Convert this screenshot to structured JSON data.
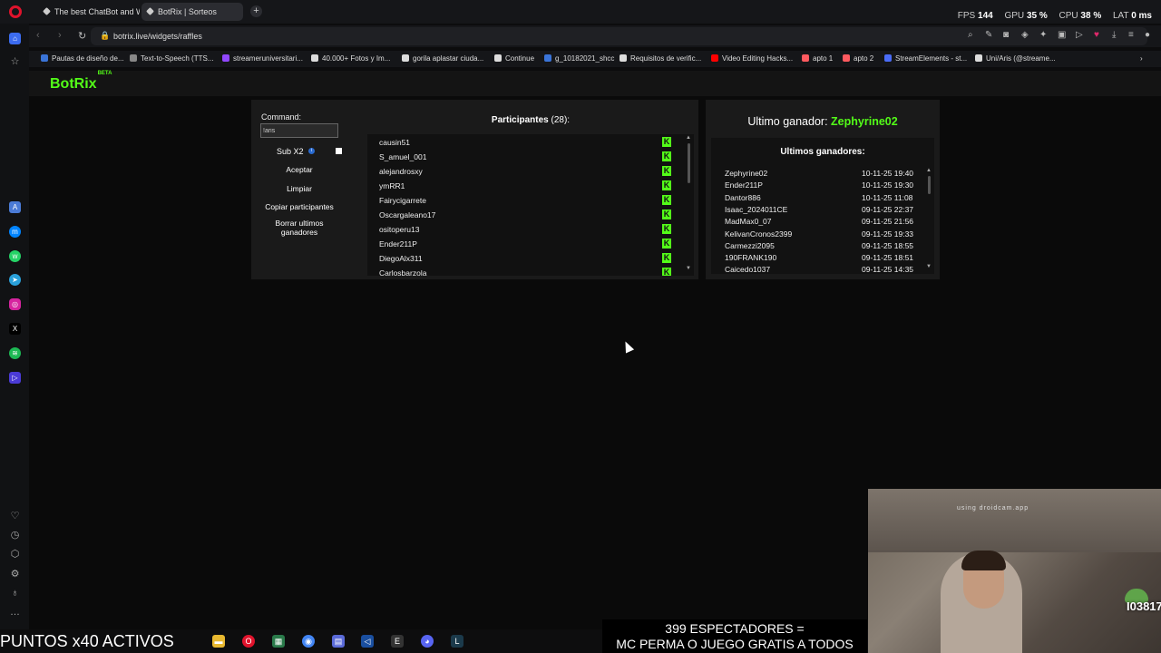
{
  "browser": {
    "tabs": [
      {
        "label": "The best ChatBot and Wi"
      },
      {
        "label": "BotRix | Sorteos"
      }
    ],
    "stats": {
      "fps_label": "FPS",
      "fps": "144",
      "gpu_label": "GPU",
      "gpu": "35 %",
      "cpu_label": "CPU",
      "cpu": "38 %",
      "lat_label": "LAT",
      "lat": "0 ms"
    },
    "url": "botrix.live/widgets/raffles",
    "bookmarks": [
      {
        "label": "Pautas de diseño de...",
        "color": "#3a74d8"
      },
      {
        "label": "Text-to-Speech (TTS...",
        "color": "#888888"
      },
      {
        "label": "streameruniversitari...",
        "color": "#9147ff"
      },
      {
        "label": "40.000+ Fotos y Im...",
        "color": "#dddddd"
      },
      {
        "label": "gorila aplastar ciuda...",
        "color": "#dddddd"
      },
      {
        "label": "Continue",
        "color": "#dddddd"
      },
      {
        "label": "g_10182021_shcc",
        "color": "#3a74d8"
      },
      {
        "label": "Requisitos de verific...",
        "color": "#dddddd"
      },
      {
        "label": "Video Editing Hacks...",
        "color": "#ff0000"
      },
      {
        "label": "apto 1",
        "color": "#ff5a5f"
      },
      {
        "label": "apto 2",
        "color": "#ff5a5f"
      },
      {
        "label": "StreamElements - st...",
        "color": "#4a6cf7"
      },
      {
        "label": "Uni/Aris (@streame...",
        "color": "#dddddd"
      }
    ]
  },
  "app": {
    "logo": "BotRix",
    "logo_badge": "BETA",
    "command_label": "Command:",
    "command_value": "!aris",
    "sub_label": "Sub X2",
    "buttons": {
      "accept": "Aceptar",
      "clear": "Limpiar",
      "copy": "Copiar participantes",
      "delete_winners": "Borrar ultimos ganadores"
    },
    "participants_title": "Participantes",
    "participants_count": "(28):",
    "participants": [
      "causin51",
      "S_amuel_001",
      "alejandrosxy",
      "ymRR1",
      "Fairycigarrete",
      "Oscargaleano17",
      "ositoperu13",
      "Ender211P",
      "DiegoAlx311",
      "Carlosbarzola"
    ],
    "platform_icon_letter": "K",
    "last_winner_label": "Ultimo ganador:",
    "last_winner": "Zephyrine02",
    "winners_title": "Ultimos ganadores:",
    "winners": [
      {
        "name": "Zephyrine02",
        "date": "10-11-25 19:40"
      },
      {
        "name": "Ender211P",
        "date": "10-11-25 19:30"
      },
      {
        "name": "Dantor886",
        "date": "10-11-25 11:08"
      },
      {
        "name": "Isaac_2024011CE",
        "date": "09-11-25 22:37"
      },
      {
        "name": "MadMax0_07",
        "date": "09-11-25 21:56"
      },
      {
        "name": "KelivanCronos2399",
        "date": "09-11-25 19:33"
      },
      {
        "name": "Carmezzi2095",
        "date": "09-11-25 18:55"
      },
      {
        "name": "190FRANK190",
        "date": "09-11-25 18:51"
      },
      {
        "name": "Caicedo1037",
        "date": "09-11-25 14:35"
      }
    ]
  },
  "overlay": {
    "points": "PUNTOS x40 ACTIVOS",
    "viewers_line1": "399 ESPECTADORES =",
    "viewers_line2": "MC PERMA O JUEGO GRATIS A TODOS",
    "cam_text": "using droidcam.app",
    "cam_badge": "I03817"
  }
}
